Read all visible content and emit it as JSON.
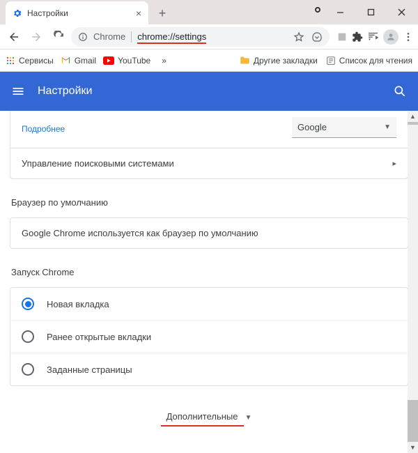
{
  "tab": {
    "title": "Настройки"
  },
  "omnibox": {
    "prefix": "Chrome",
    "url": "chrome://settings"
  },
  "bookmarks": {
    "services": "Сервисы",
    "gmail": "Gmail",
    "youtube": "YouTube",
    "overflow": "»",
    "other": "Другие закладки",
    "reading": "Список для чтения"
  },
  "bluebar": {
    "title": "Настройки"
  },
  "search_engine": {
    "more": "Подробнее",
    "selected": "Google",
    "manage": "Управление поисковыми системами"
  },
  "default_browser": {
    "title": "Браузер по умолчанию",
    "text": "Google Chrome используется как браузер по умолчанию"
  },
  "startup": {
    "title": "Запуск Chrome",
    "options": [
      "Новая вкладка",
      "Ранее открытые вкладки",
      "Заданные страницы"
    ]
  },
  "advanced": "Дополнительные"
}
